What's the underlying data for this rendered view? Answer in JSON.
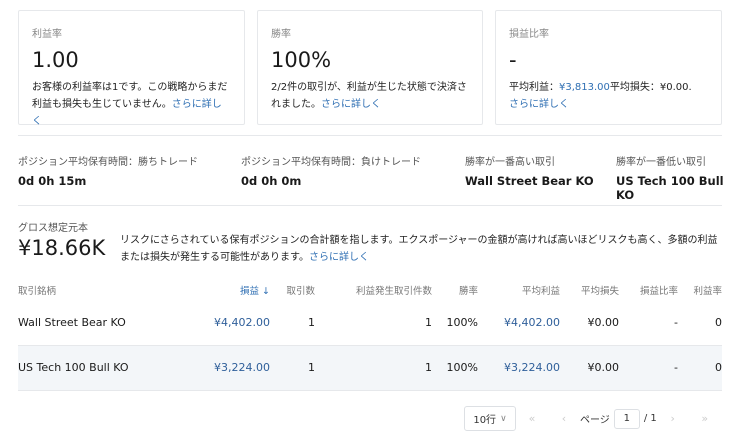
{
  "cards": [
    {
      "label": "利益率",
      "value": "1.00",
      "desc": "お客様の利益率は1です。この戦略からまだ利益も損失も生じていません。",
      "link": "さらに詳しく"
    },
    {
      "label": "勝率",
      "value": "100%",
      "desc": "2/2件の取引が、利益が生じた状態で決済されました。",
      "link": "さらに詳しく"
    },
    {
      "label": "損益比率",
      "value": "-",
      "avg_profit_label": "平均利益：",
      "avg_profit": "¥3,813.00",
      "avg_loss_text": "平均損失：¥0.00.",
      "link": "さらに詳しく"
    }
  ],
  "stats": [
    {
      "label": "ポジション平均保有時間：勝ちトレード",
      "value": "0d 0h 15m"
    },
    {
      "label": "ポジション平均保有時間：負けトレード",
      "value": "0d 0h 0m"
    },
    {
      "label": "勝率が一番高い取引",
      "value": "Wall Street Bear KO"
    },
    {
      "label": "勝率が一番低い取引",
      "value": "US Tech 100 Bull KO"
    }
  ],
  "gross": {
    "label": "グロス想定元本",
    "value": "¥18.66K",
    "desc": "リスクにさらされている保有ポジションの合計額を指します。エクスポージャーの金額が高ければ高いほどリスクも高く、多額の利益または損失が発生する可能性があります。",
    "link": "さらに詳しく"
  },
  "table": {
    "headers": [
      "取引銘柄",
      "損益",
      "取引数",
      "利益発生取引件数",
      "勝率",
      "平均利益",
      "平均損失",
      "損益比率",
      "利益率"
    ],
    "sort_icon": "↓",
    "rows": [
      [
        "Wall Street Bear KO",
        "¥4,402.00",
        "1",
        "1",
        "100%",
        "¥4,402.00",
        "¥0.00",
        "-",
        "0"
      ],
      [
        "US Tech 100 Bull KO",
        "¥3,224.00",
        "1",
        "1",
        "100%",
        "¥3,224.00",
        "¥0.00",
        "-",
        "0"
      ]
    ]
  },
  "pagination": {
    "rows_per_page": "10行",
    "page_label": "ページ",
    "page": "1",
    "total": "/ 1"
  }
}
